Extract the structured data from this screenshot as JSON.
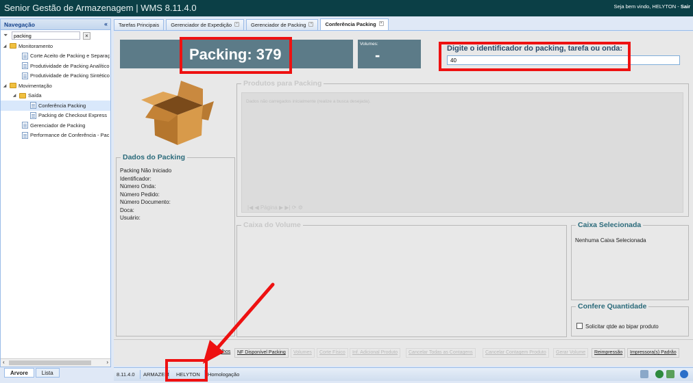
{
  "header": {
    "app_title": "Senior Gestão de Armazenagem | WMS 8.11.4.0",
    "welcome_text": "Seja bem vindo, HELYTON -",
    "logout_label": "Sair"
  },
  "nav": {
    "title": "Navegação",
    "collapse_glyph": "«",
    "search_value": "packing",
    "clear_glyph": "×",
    "tree": [
      {
        "label": "Monitoramento"
      },
      {
        "label": "Corte Aceito de Packing e Separaç"
      },
      {
        "label": "Produtividade de Packing Analítico"
      },
      {
        "label": "Produtividade de Packing Sintético"
      },
      {
        "label": "Movimentação"
      },
      {
        "label": "Saída"
      },
      {
        "label": "Conferência Packing"
      },
      {
        "label": "Packing de Checkout Express"
      },
      {
        "label": "Gerenciador de Packing"
      },
      {
        "label": "Performance de Conferência - Pac"
      }
    ],
    "bottom_tabs": [
      "Arvore",
      "Lista"
    ]
  },
  "tabs": [
    {
      "label": "Tarefas Principais"
    },
    {
      "label": "Gerenciador de Expedição"
    },
    {
      "label": "Gerenciador de Packing"
    },
    {
      "label": "Conferência Packing"
    }
  ],
  "packing": {
    "title": "Packing: 379",
    "volumes_label": "Volumes:",
    "volumes_value": "-",
    "prompt": "Digite o identificador do packing, tarefa ou onda:",
    "id_value": "40"
  },
  "produtos": {
    "legend": "Produtos para Packing",
    "empty_msg": "Dados não carregados inicialmente (realize a busca desejada).",
    "pager": "|◀ ◀  Página  ▶ ▶|  ⟳  ⚙"
  },
  "dados": {
    "legend": "Dados do Packing",
    "lines": [
      "Packing Não Iniciado",
      "Identificador:",
      "Número Onda:",
      "Número Pedido:",
      "Número Documento:",
      "Doca:",
      "Usuário:"
    ]
  },
  "caixa_volume": {
    "legend": "Caixa do Volume"
  },
  "caixa_sel": {
    "legend": "Caixa Selecionada",
    "text": "Nenhuma Caixa Selecionada"
  },
  "confere": {
    "legend": "Confere Quantidade",
    "checkbox_label": "Solicitar qtde ao bipar produto",
    "checked": false
  },
  "toolbar": [
    {
      "label": "Atalhos"
    },
    {
      "label": "NF Disponível Packing"
    },
    {
      "label": "Volumes"
    },
    {
      "label": "Corte Físico"
    },
    {
      "label": "Inf. Adicional Produto"
    },
    {
      "label": "Cancelar Todas as Contagens"
    },
    {
      "label": "Cancelar Contagem Produto"
    },
    {
      "label": "Gerar Volume"
    },
    {
      "label": "Reimpressão"
    },
    {
      "label": "Impressora(s) Padrão"
    }
  ],
  "status": {
    "version": "8.11.4.0",
    "warehouse": "ARMAZEM",
    "user": "HELYTON",
    "environment": "Homologação"
  },
  "colors": {
    "titlebar": "#0b3f46",
    "header_box": "#5c7b88",
    "highlight": "#ee1111",
    "legend": "#2a6a7a"
  }
}
